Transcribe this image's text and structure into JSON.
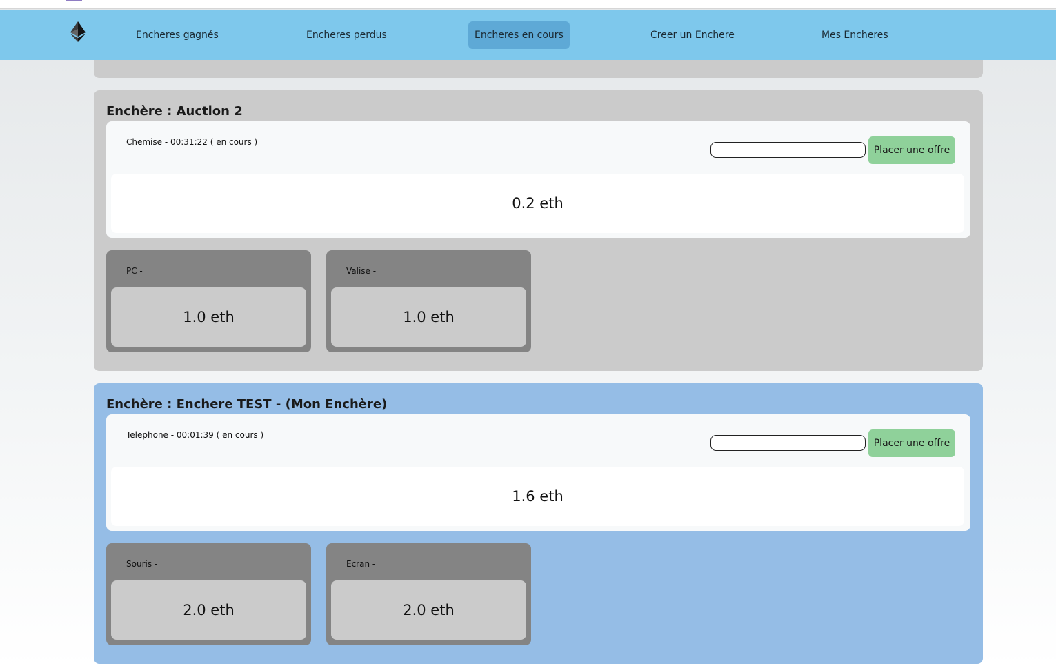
{
  "nav": {
    "items": [
      {
        "label": "Encheres gagnés"
      },
      {
        "label": "Encheres perdus"
      },
      {
        "label": "Encheres en cours"
      },
      {
        "label": "Creer un Enchere"
      },
      {
        "label": "Mes Encheres"
      }
    ],
    "active_label": "Encheres en cours",
    "logo_icon": "ethereum-icon"
  },
  "auctions": [
    {
      "title": "Enchère : Auction 2",
      "panel_color": "#cbcbcb",
      "main_item": {
        "title": "Chemise - 00:31:22 ( en cours )",
        "bid_input_value": "",
        "bid_button_label": "Placer une offre",
        "price": "0.2 eth"
      },
      "other_items": [
        {
          "title": "PC -",
          "price": "1.0 eth"
        },
        {
          "title": "Valise -",
          "price": "1.0 eth"
        }
      ]
    },
    {
      "title": "Enchère : Enchere TEST - (Mon Enchère)",
      "panel_color": "#95bde6",
      "main_item": {
        "title": "Telephone - 00:01:39 ( en cours )",
        "bid_input_value": "",
        "bid_button_label": "Placer une offre",
        "price": "1.6 eth"
      },
      "other_items": [
        {
          "title": "Souris -",
          "price": "2.0 eth"
        },
        {
          "title": "Ecran -",
          "price": "2.0 eth"
        }
      ]
    }
  ],
  "colors": {
    "navbar": "#7ec8ec",
    "nav_active": "#5ea9d6",
    "bid_button": "#8fd19a",
    "item_card": "#848484"
  }
}
